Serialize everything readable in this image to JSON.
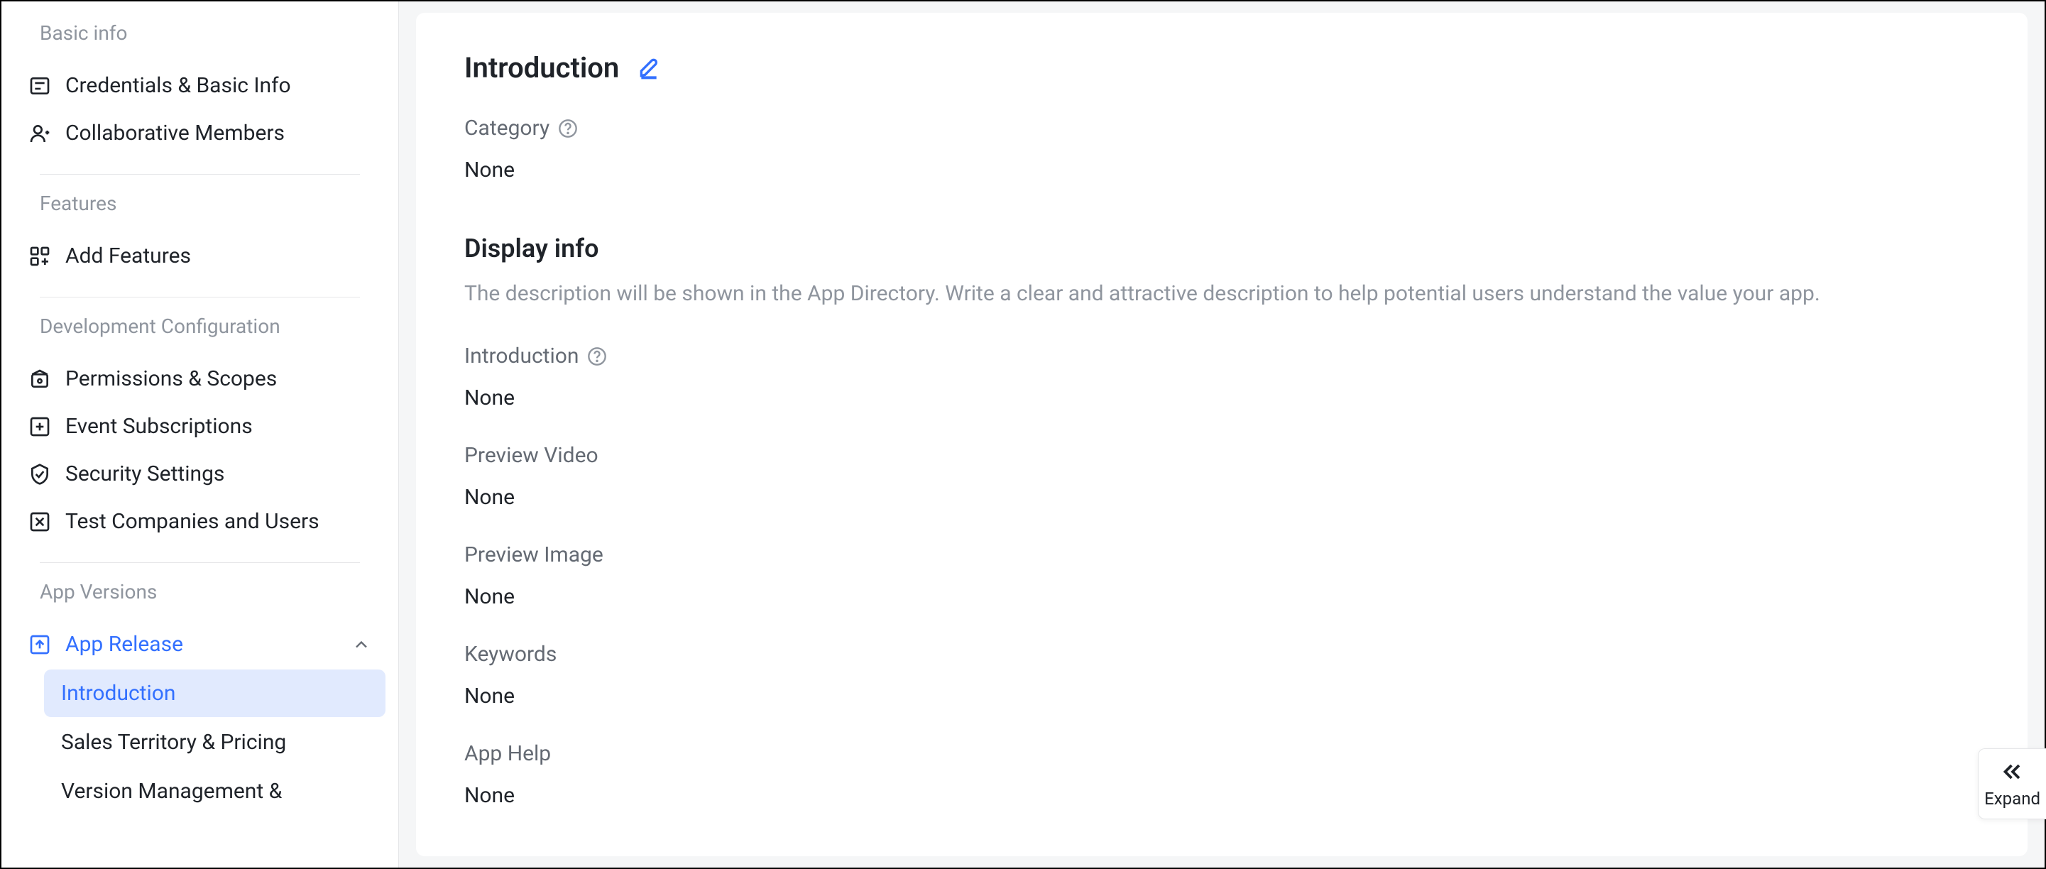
{
  "sidebar": {
    "sections": {
      "basic_info": {
        "label": "Basic info",
        "items": [
          {
            "label": "Credentials & Basic Info"
          },
          {
            "label": "Collaborative Members"
          }
        ]
      },
      "features": {
        "label": "Features",
        "items": [
          {
            "label": "Add Features"
          }
        ]
      },
      "dev_config": {
        "label": "Development Configuration",
        "items": [
          {
            "label": "Permissions & Scopes"
          },
          {
            "label": "Event Subscriptions"
          },
          {
            "label": "Security Settings"
          },
          {
            "label": "Test Companies and Users"
          }
        ]
      },
      "app_versions": {
        "label": "App Versions",
        "items": [
          {
            "label": "App Release",
            "expanded": true,
            "children": [
              {
                "label": "Introduction",
                "active": true
              },
              {
                "label": "Sales Territory & Pricing"
              },
              {
                "label": "Version Management &"
              }
            ]
          }
        ]
      }
    }
  },
  "main": {
    "introduction": {
      "title": "Introduction",
      "fields": {
        "category": {
          "label": "Category",
          "value": "None"
        }
      }
    },
    "display_info": {
      "title": "Display info",
      "description": "The description will be shown in the App Directory. Write a clear and attractive description to help potential users understand the value your app.",
      "fields": {
        "introduction": {
          "label": "Introduction",
          "value": "None"
        },
        "preview_video": {
          "label": "Preview Video",
          "value": "None"
        },
        "preview_image": {
          "label": "Preview Image",
          "value": "None"
        },
        "keywords": {
          "label": "Keywords",
          "value": "None"
        },
        "app_help": {
          "label": "App Help",
          "value": "None"
        }
      }
    }
  },
  "expand_button": {
    "label": "Expand"
  }
}
